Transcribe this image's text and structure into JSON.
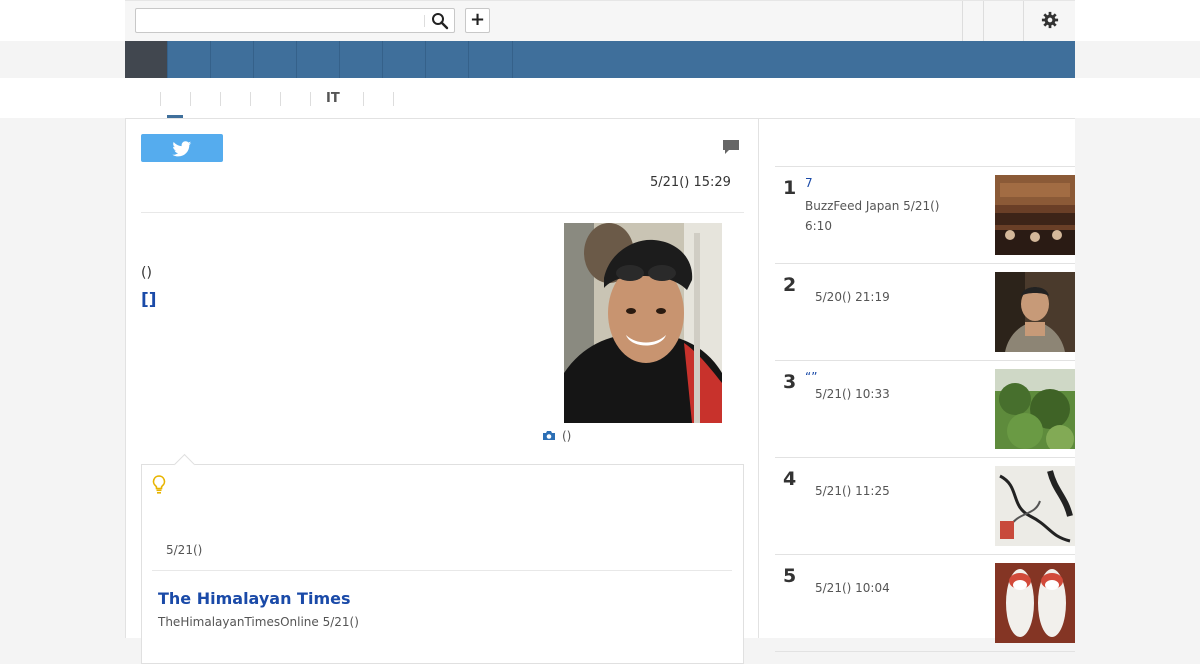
{
  "header": {
    "search": {
      "value": "",
      "placeholder": ""
    },
    "add_label": "+"
  },
  "subnav": {
    "tabs": [
      "",
      "",
      "",
      "",
      "",
      "IT",
      "",
      ""
    ]
  },
  "article": {
    "datetime": "5/21() 15:29",
    "paren_text": "()",
    "bracket_link": "[]",
    "photo_caption": "()"
  },
  "related": {
    "date": "5/21()",
    "source_name": "The Himalayan Times",
    "source_sub": "TheHimalayanTimesOnline 5/21()"
  },
  "ranking": [
    {
      "rank": "1",
      "title": "7",
      "meta": "BuzzFeed Japan   5/21() 6:10"
    },
    {
      "rank": "2",
      "title": "",
      "meta": "5/20()     21:19"
    },
    {
      "rank": "3",
      "title": "“”",
      "meta": "5/21()     10:33"
    },
    {
      "rank": "4",
      "title": "",
      "meta": "5/21()     11:25"
    },
    {
      "rank": "5",
      "title": "",
      "meta": "5/21()     10:04"
    }
  ],
  "colors": {
    "nav_bg": "#3f6f9b",
    "nav_active": "#41474f",
    "link": "#1a4aa8",
    "twitter": "#55acee"
  }
}
